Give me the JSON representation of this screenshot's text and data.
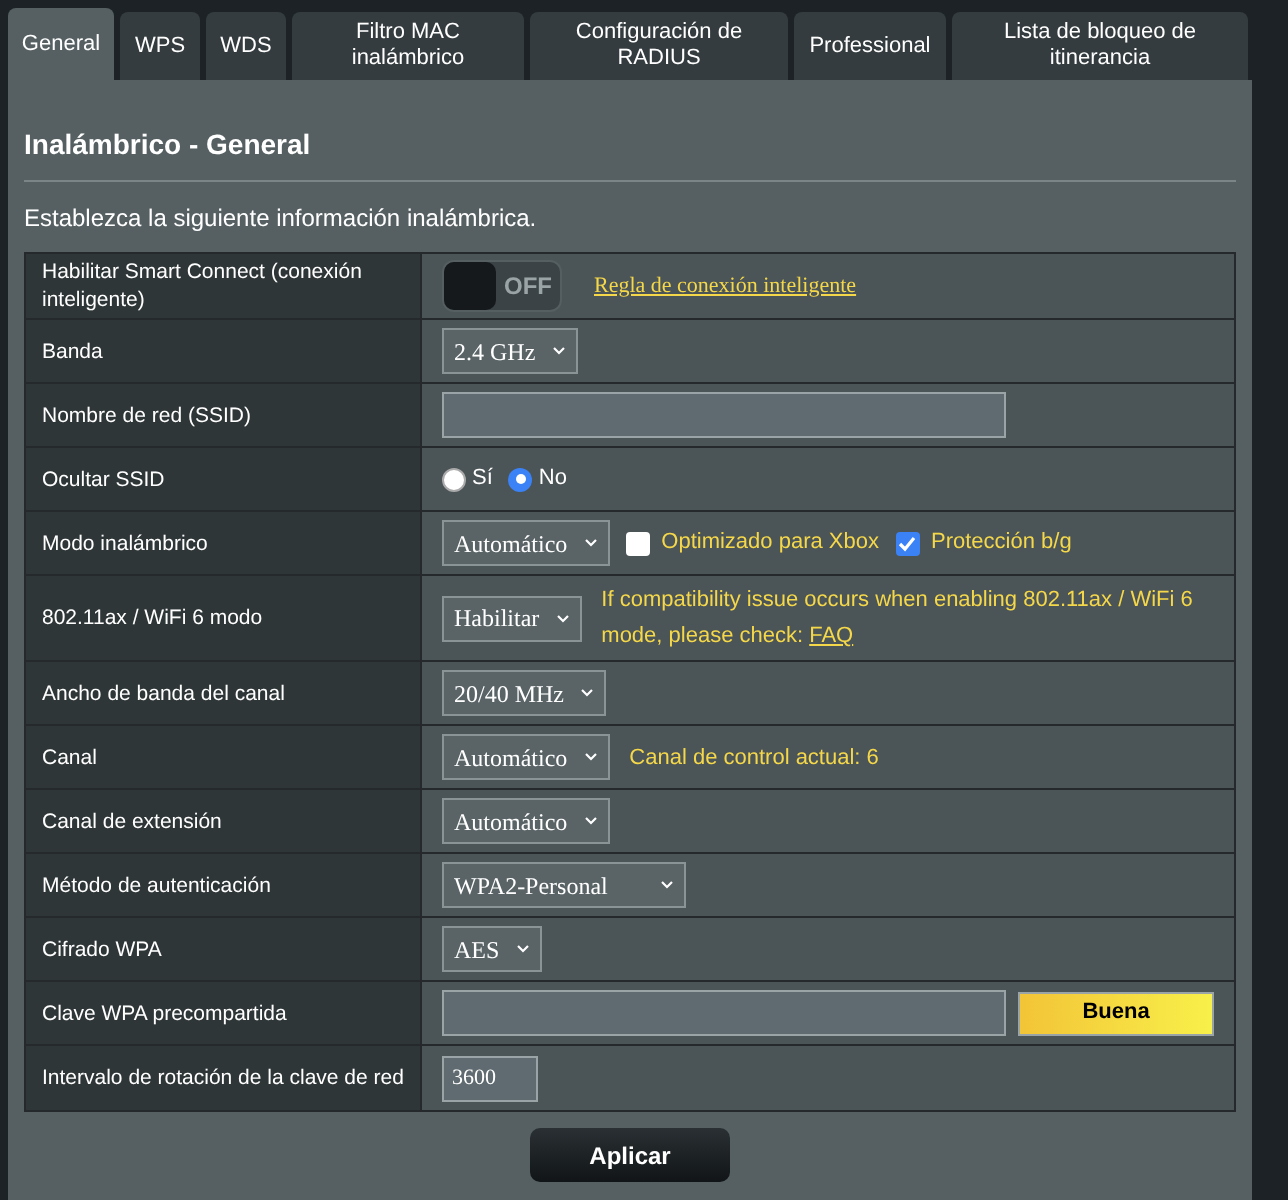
{
  "tabs": [
    {
      "label": "General",
      "selected": true
    },
    {
      "label": "WPS",
      "selected": false
    },
    {
      "label": "WDS",
      "selected": false
    },
    {
      "label": "Filtro MAC inalámbrico",
      "selected": false
    },
    {
      "label": "Configuración de RADIUS",
      "selected": false
    },
    {
      "label": "Professional",
      "selected": false
    },
    {
      "label": "Lista de bloqueo de itinerancia",
      "selected": false
    }
  ],
  "title": "Inalámbrico - General",
  "description": "Establezca la siguiente información inalámbrica.",
  "rows": [
    {
      "label": "Habilitar Smart Connect (conexión inteligente)",
      "kind": "toggle",
      "on": false,
      "switch_text": "OFF",
      "link": "Regla de conexión inteligente"
    },
    {
      "label": "Banda",
      "kind": "select",
      "value": "2.4 GHz"
    },
    {
      "label": "Nombre de red (SSID)",
      "kind": "text",
      "wide": true
    },
    {
      "label": "Ocultar SSID",
      "kind": "radio",
      "options": [
        {
          "label": "Sí",
          "selected": false
        },
        {
          "label": "No",
          "selected": true
        }
      ]
    },
    {
      "label": "Modo inalámbrico",
      "kind": "select",
      "value": "Automático",
      "checkboxes": [
        {
          "label": "Optimizado para Xbox",
          "checked": false
        },
        {
          "label": "Protección b/g",
          "checked": true
        }
      ]
    },
    {
      "label": "802.11ax / WiFi 6 modo",
      "kind": "select",
      "value": "Habilitar",
      "note": "If compatibility issue occurs when enabling 802.11ax / WiFi 6 mode, please check: ",
      "note_link": "FAQ"
    },
    {
      "label": "Ancho de banda del canal",
      "kind": "select",
      "value": "20/40 MHz"
    },
    {
      "label": "Canal",
      "kind": "select",
      "value": "Automático",
      "note": "Canal de control actual: 6"
    },
    {
      "label": "Canal de extensión",
      "kind": "select",
      "value": "Automático"
    },
    {
      "label": "Método de autenticación",
      "kind": "select",
      "value": "WPA2-Personal"
    },
    {
      "label": "Cifrado WPA",
      "kind": "select",
      "value": "AES"
    },
    {
      "label": "Clave WPA precompartida",
      "kind": "text",
      "wide": true,
      "strength": "Buena"
    },
    {
      "label": "Intervalo de rotación de la clave de red",
      "kind": "text",
      "wide": false,
      "value": "3600"
    }
  ],
  "apply_button": "Aplicar"
}
